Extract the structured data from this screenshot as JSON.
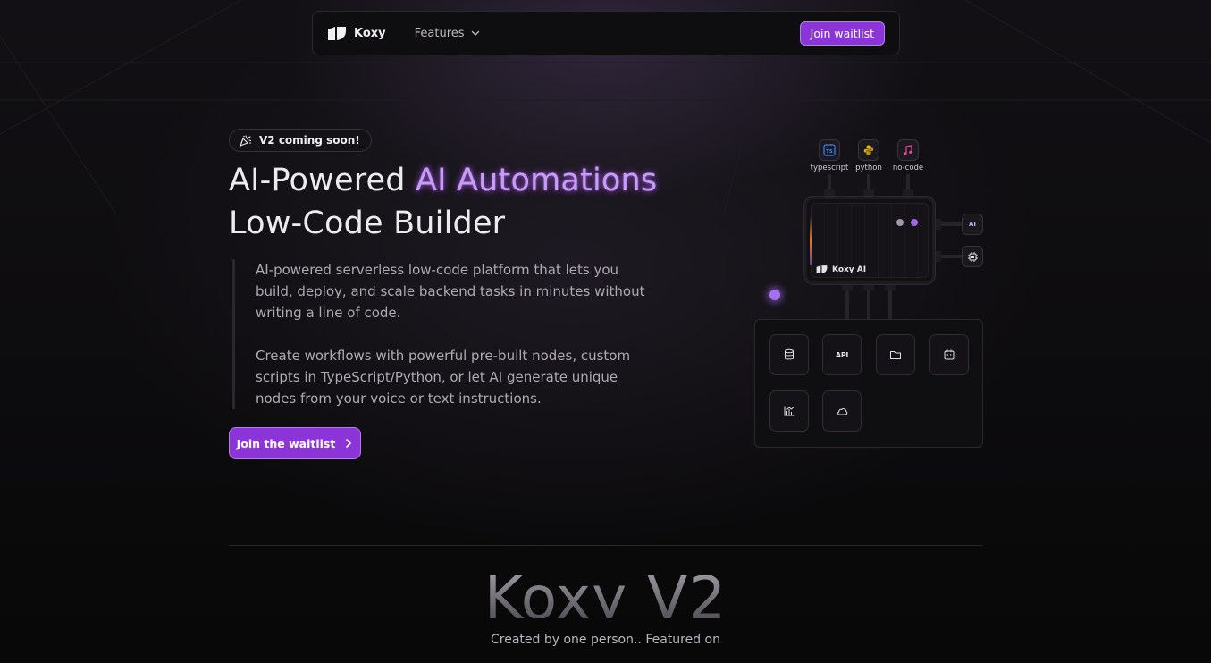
{
  "nav": {
    "brand": "Koxy",
    "features_label": "Features",
    "cta_label": "Join waitlist"
  },
  "hero": {
    "badge": "V2 coming soon!",
    "title_part1": "AI-Powered ",
    "title_highlight": "AI Automations",
    "title_line2": "Low-Code Builder",
    "paragraph1": "AI-powered serverless low-code platform that lets you build, deploy, and scale backend tasks in minutes without writing a line of code.",
    "paragraph2": "Create workflows with powerful pre-built nodes, custom scripts in TypeScript/Python, or let AI generate unique nodes from your voice or text instructions.",
    "cta_label": "Join the waitlist"
  },
  "diagram": {
    "languages": [
      {
        "label": "typescript",
        "icon": "typescript-icon",
        "color": "#3b82f6"
      },
      {
        "label": "python",
        "icon": "python-icon",
        "color": "#eab308"
      },
      {
        "label": "no-code",
        "icon": "music-note-icon",
        "color": "#ec4899"
      }
    ],
    "chip_label": "Koxy AI",
    "side_ai_label": "AI",
    "side_cpu_icon": "cpu-icon",
    "node_api_label": "API",
    "nodes": [
      "database-icon",
      "api-icon",
      "folder-icon",
      "calendar-bot-icon",
      "chart-icon",
      "cloud-icon"
    ]
  },
  "footer": {
    "big_title": "Koxy V2",
    "created_text": "Created by one person.. Featured on"
  },
  "colors": {
    "accent": "#8b35d8",
    "accent_border": "#b47cf0",
    "highlight_text": "#c79df2",
    "background": "#0b0a0c"
  }
}
